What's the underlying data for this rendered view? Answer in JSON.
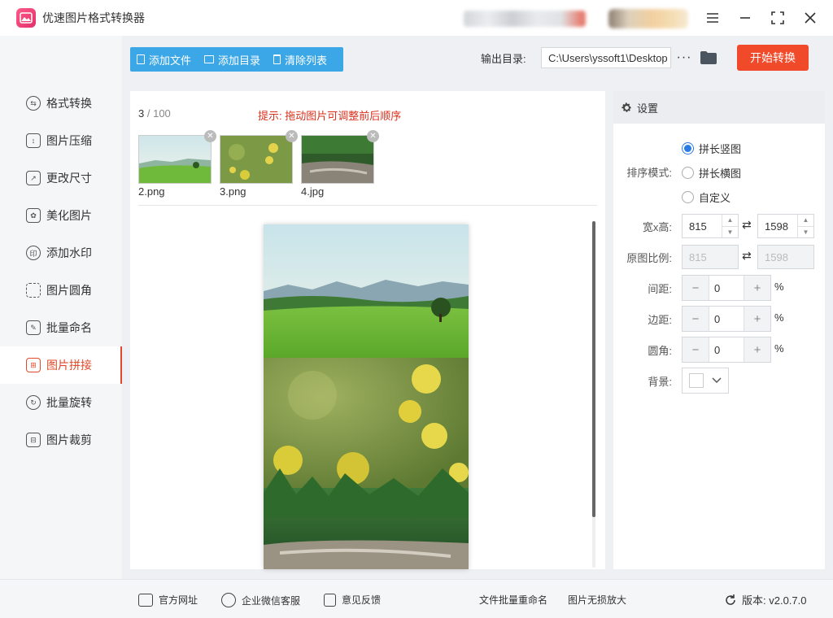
{
  "window": {
    "title": "优速图片格式转换器"
  },
  "sidebar": {
    "items": [
      {
        "label": "格式转换",
        "icon": "convert-icon"
      },
      {
        "label": "图片压缩",
        "icon": "compress-icon"
      },
      {
        "label": "更改尺寸",
        "icon": "resize-icon"
      },
      {
        "label": "美化图片",
        "icon": "beautify-icon"
      },
      {
        "label": "添加水印",
        "icon": "watermark-icon"
      },
      {
        "label": "图片圆角",
        "icon": "round-corner-icon"
      },
      {
        "label": "批量命名",
        "icon": "rename-icon"
      },
      {
        "label": "图片拼接",
        "icon": "stitch-icon",
        "active": true
      },
      {
        "label": "批量旋转",
        "icon": "rotate-icon"
      },
      {
        "label": "图片裁剪",
        "icon": "crop-icon"
      }
    ]
  },
  "toolbar": {
    "add_file": "添加文件",
    "add_dir": "添加目录",
    "clear_list": "清除列表",
    "output_label": "输出目录:",
    "output_path": "C:\\Users\\yssoft1\\Desktop",
    "more": "···",
    "start": "开始转换"
  },
  "main": {
    "count_current": "3",
    "count_total": "/ 100",
    "hint": "提示: 拖动图片可调整前后顺序",
    "files": [
      {
        "name": "2.png"
      },
      {
        "name": "3.png"
      },
      {
        "name": "4.jpg"
      }
    ]
  },
  "settings": {
    "title": "设置",
    "sort_label": "排序模式:",
    "sort_options": [
      "拼长竖图",
      "拼长横图",
      "自定义"
    ],
    "sort_selected": "拼长竖图",
    "wh_label": "宽x高:",
    "width": "815",
    "height": "1598",
    "ratio_label": "原图比例:",
    "ratio_w": "815",
    "ratio_h": "1598",
    "spacing_label": "间距:",
    "spacing": "0",
    "margin_label": "边距:",
    "margin": "0",
    "radius_label": "圆角:",
    "radius": "0",
    "percent": "%",
    "bg_label": "背景:",
    "bg_color": "#ffffff"
  },
  "footer": {
    "website": "官方网址",
    "wechat": "企业微信客服",
    "feedback": "意见反馈",
    "batch_rename": "文件批量重命名",
    "lossless": "图片无损放大",
    "version": "版本: v2.0.7.0"
  },
  "colors": {
    "accent": "#f04a2a",
    "primary": "#3ca7e6"
  }
}
